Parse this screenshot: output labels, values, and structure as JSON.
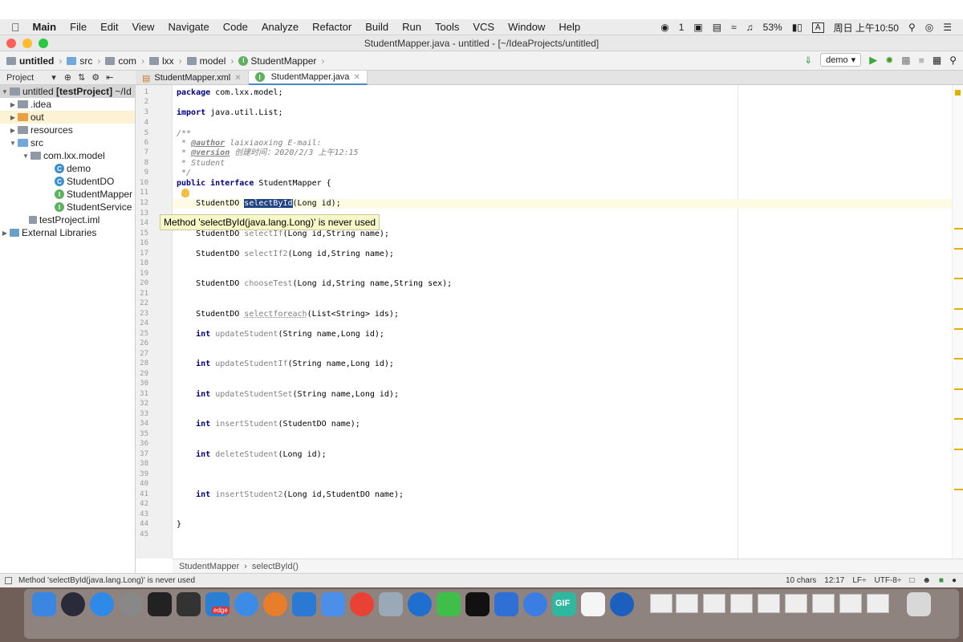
{
  "menubar": {
    "app": "Main",
    "items": [
      "File",
      "Edit",
      "View",
      "Navigate",
      "Code",
      "Analyze",
      "Refactor",
      "Build",
      "Run",
      "Tools",
      "VCS",
      "Window",
      "Help"
    ],
    "tray": {
      "wechat_count": "1",
      "battery": "53%",
      "input": "A",
      "clock": "周日 上午10:50"
    }
  },
  "window": {
    "title": "StudentMapper.java - untitled - [~/IdeaProjects/untitled]"
  },
  "navbar": {
    "crumbs": [
      "untitled",
      "src",
      "com",
      "lxx",
      "model",
      "StudentMapper"
    ],
    "run_config": "demo"
  },
  "project_panel": {
    "label": "Project"
  },
  "tabs": [
    {
      "label": "StudentMapper.xml"
    },
    {
      "label": "StudentMapper.java"
    }
  ],
  "tree": [
    {
      "label": "untitled",
      "bold": "[testProject]",
      "extra": "~/Id"
    },
    {
      "label": ".idea"
    },
    {
      "label": "out"
    },
    {
      "label": "resources"
    },
    {
      "label": "src"
    },
    {
      "label": "com.lxx.model"
    },
    {
      "label": "demo"
    },
    {
      "label": "StudentDO"
    },
    {
      "label": "StudentMapper"
    },
    {
      "label": "StudentService"
    },
    {
      "label": "testProject.iml"
    },
    {
      "label": "External Libraries"
    }
  ],
  "code": {
    "l1": "com.lxx.model;",
    "l3": "java.util.List;",
    "l5": "/**",
    "l6a": " * ",
    "l6b": "@author",
    "l6c": " laixiaoxing E-mail:",
    "l7a": " * ",
    "l7b": "@version",
    "l7c": " 创建时间：2020/2/3 上午12:15",
    "l8": " * Student",
    "l9": " */",
    "l10": "StudentMapper {",
    "l12a": "    StudentDO ",
    "l12b": "selectById",
    "l12c": "(Long id);",
    "l15a": "    StudentDO ",
    "l15b": "selectIf",
    "l15c": "(Long id,String name);",
    "l17a": "    StudentDO ",
    "l17b": "selectIf2",
    "l17c": "(Long id,String name);",
    "l20a": "    StudentDO ",
    "l20b": "chooseTest",
    "l20c": "(Long id,String name,String sex);",
    "l23a": "    StudentDO ",
    "l23b": "selectforeach",
    "l23c": "(List<String> ids);",
    "l25b": "updateStudent",
    "l25c": "(String name,Long id);",
    "l28b": "updateStudentIf",
    "l28c": "(String name,Long id);",
    "l31b": "updateStudentSet",
    "l31c": "(String name,Long id);",
    "l34b": "insertStudent",
    "l34c": "(StudentDO name);",
    "l37b": "deleteStudent",
    "l37c": "(Long id);",
    "l41b": "insertStudent2",
    "l41c": "(Long id,StudentDO name);",
    "l44": "}",
    "kw_package": "package",
    "kw_import": "import",
    "kw_public": "public",
    "kw_interface": "interface",
    "kw_int": "int"
  },
  "tooltip": "Method 'selectById(java.lang.Long)' is never used",
  "editor_breadcrumb": [
    "StudentMapper",
    "selectById()"
  ],
  "status": {
    "message": "Method 'selectById(java.lang.Long)' is never used",
    "chars": "10 chars",
    "pos": "12:17",
    "eol": "LF÷",
    "enc": "UTF-8÷"
  },
  "dock": {
    "gif_label": "GIF",
    "edge_label": "edge"
  }
}
